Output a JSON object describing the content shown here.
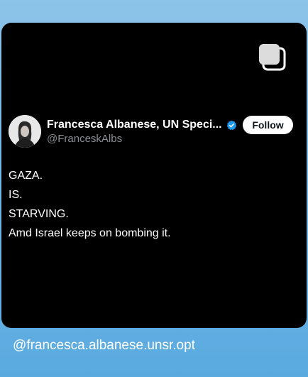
{
  "tweet": {
    "display_name": "Francesca Albanese, UN Speci...",
    "handle": "@FranceskAlbs",
    "follow_label": "Follow",
    "lines": [
      "GAZA.",
      "IS.",
      "STARVING.",
      "Amd Israel keeps on bombing it."
    ],
    "verified": true
  },
  "caption": {
    "mention": "@francesca.albanese.unsr.opt"
  },
  "icons": {
    "multi_select": "copy-stack-icon",
    "verified": "verified-badge-icon"
  },
  "colors": {
    "card_background": "#000000",
    "verified_badge": "#1d9bf0",
    "handle_text": "#8b8f94",
    "story_background": "#72b6e4"
  }
}
